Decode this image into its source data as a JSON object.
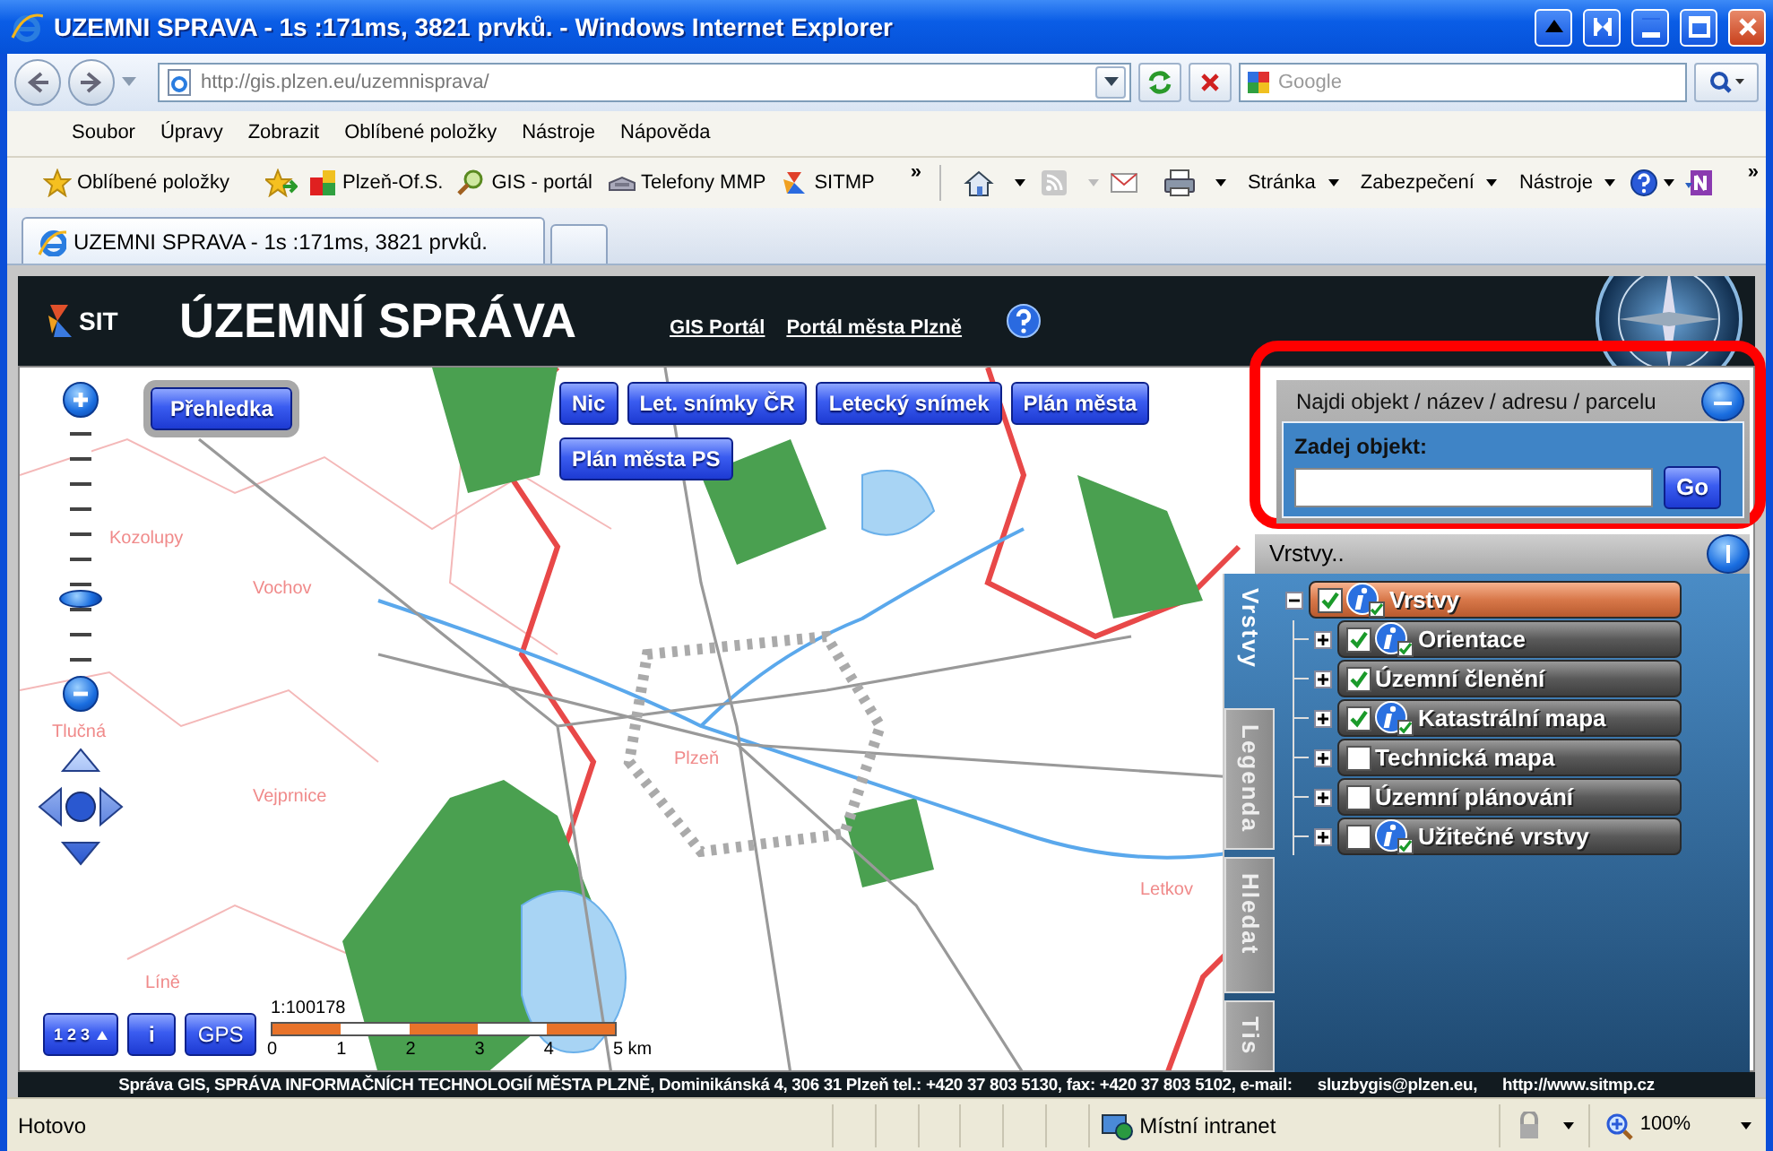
{
  "window": {
    "title": "UZEMNI SPRAVA - 1s :171ms, 3821 prvků. - Windows Internet Explorer"
  },
  "address_bar": {
    "url": "http://gis.plzen.eu/uzemnisprava/"
  },
  "search_box": {
    "placeholder": "Google"
  },
  "menu_bar": [
    "Soubor",
    "Úpravy",
    "Zobrazit",
    "Oblíbené položky",
    "Nástroje",
    "Nápověda"
  ],
  "favorites_bar": {
    "favorites": "Oblíbené položky",
    "links": [
      {
        "label": "Plzeň-Of.S.",
        "kind": "squares"
      },
      {
        "label": "GIS - portál",
        "kind": "magnifier"
      },
      {
        "label": "Telefony MMP",
        "kind": "phone"
      },
      {
        "label": "SITMP",
        "kind": "logo"
      }
    ],
    "links_more": "»",
    "commands": [
      "Stránka",
      "Zabezpečení",
      "Nástroje"
    ],
    "commands_more": "»"
  },
  "tabs": [
    {
      "label": "UZEMNI SPRAVA - 1s :171ms, 3821 prvků.",
      "selected": true
    }
  ],
  "page_header": {
    "logo": "SIT",
    "title": "ÚZEMNÍ SPRÁVA",
    "links": [
      "GIS Portál",
      "Portál města Plzně"
    ]
  },
  "map": {
    "overview_button": "Přehledka",
    "basemaps": [
      "Nic",
      "Let. snímky ČR",
      "Letecký snímek",
      "Plán města",
      "Plán města PS"
    ],
    "place_labels": [
      "Kozolupy",
      "Vochov",
      "Tlučná",
      "Vejprnice",
      "Líně",
      "Plzeň",
      "Letkov"
    ],
    "zoom": {
      "level": 0.27
    },
    "tools": [
      {
        "kind": "ruler",
        "label": "1 2 3"
      },
      {
        "kind": "info",
        "label": "i"
      },
      {
        "kind": "gps",
        "label": "GPS"
      }
    ],
    "scale": {
      "ratio": "1:100178",
      "ticks": [
        "0",
        "1",
        "2",
        "3",
        "4",
        "5 km"
      ]
    }
  },
  "search_panel": {
    "title": "Najdi objekt / název / adresu / parcelu",
    "field_label": "Zadej objekt:",
    "button": "Go"
  },
  "layers_panel": {
    "title": "Vrstvy..",
    "side_tabs": [
      {
        "label": "Vrstvy",
        "selected": true
      },
      {
        "label": "Legenda",
        "selected": false
      },
      {
        "label": "Hledat",
        "selected": false
      },
      {
        "label": "Tis",
        "selected": false
      }
    ],
    "tree": [
      {
        "label": "Vrstvy",
        "checked": true,
        "info": true,
        "expanded": true,
        "selected": true,
        "children": [
          {
            "label": "Orientace",
            "checked": true,
            "info": true,
            "expanded": false,
            "selected": false
          },
          {
            "label": "Územní členění",
            "checked": true,
            "info": false,
            "expanded": false,
            "selected": false
          },
          {
            "label": "Katastrální mapa",
            "checked": true,
            "info": true,
            "expanded": false,
            "selected": false
          },
          {
            "label": "Technická mapa",
            "checked": false,
            "info": false,
            "expanded": false,
            "selected": false
          },
          {
            "label": "Územní plánování",
            "checked": false,
            "info": false,
            "expanded": false,
            "selected": false
          },
          {
            "label": "Užitečné vrstvy",
            "checked": false,
            "info": true,
            "expanded": false,
            "selected": false
          }
        ]
      }
    ]
  },
  "footer": {
    "text": "Správa GIS, SPRÁVA INFORMAČNÍCH TECHNOLOGIÍ MĚSTA PLZNĚ, Dominikánská 4, 306 31 Plzeň tel.: +420 37 803 5130, fax: +420 37 803 5102, e-mail:",
    "links": [
      "sluzbygis@plzen.eu,",
      "http://www.sitmp.cz"
    ]
  },
  "status_bar": {
    "text": "Hotovo",
    "zone": "Místní intranet",
    "zoom": "100%"
  }
}
